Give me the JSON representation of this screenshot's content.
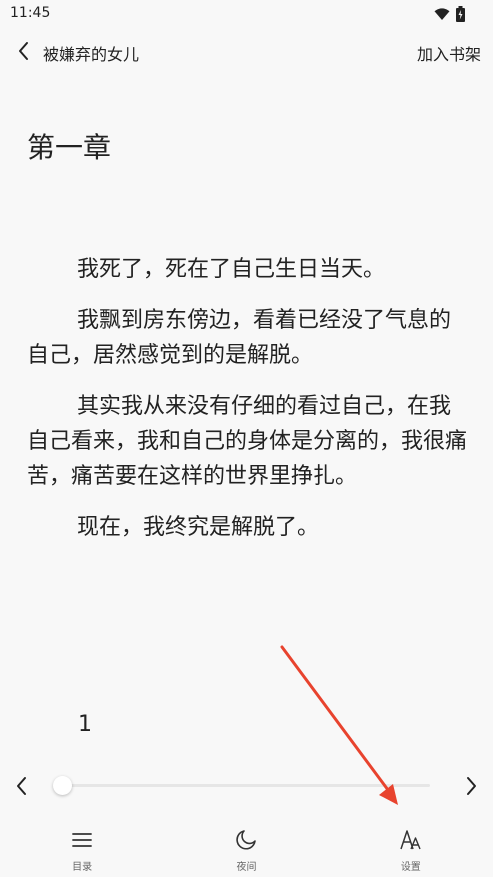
{
  "status_bar": {
    "time": "11:45",
    "icons": [
      "wifi-icon",
      "battery-icon"
    ]
  },
  "header": {
    "back_icon": "back-icon",
    "book_title": "被嫌弃的女儿",
    "add_to_shelf": "加入书架"
  },
  "chapter": {
    "title": "第一章",
    "paragraphs": [
      "我死了，死在了自己生日当天。",
      "我飘到房东傍边，看着已经没了气息的自己，居然感觉到的是解脱。",
      "其实我从来没有仔细的看过自己，在我自己看来，我和自己的身体是分离的，我很痛苦，痛苦要在这样的世界里挣扎。",
      "现在，我终究是解脱了。"
    ],
    "page_number": "1"
  },
  "progress": {
    "value_fraction": 0.01,
    "prev_icon": "chevron-left-icon",
    "next_icon": "chevron-right-icon"
  },
  "bottom_nav": {
    "items": [
      {
        "label": "目录",
        "icon": "menu-icon"
      },
      {
        "label": "夜间",
        "icon": "moon-icon"
      },
      {
        "label": "设置",
        "icon": "font-settings-icon"
      }
    ]
  },
  "colors": {
    "background": "#f8f8f8",
    "text": "#222222",
    "annotation_arrow": "#e8432e"
  }
}
